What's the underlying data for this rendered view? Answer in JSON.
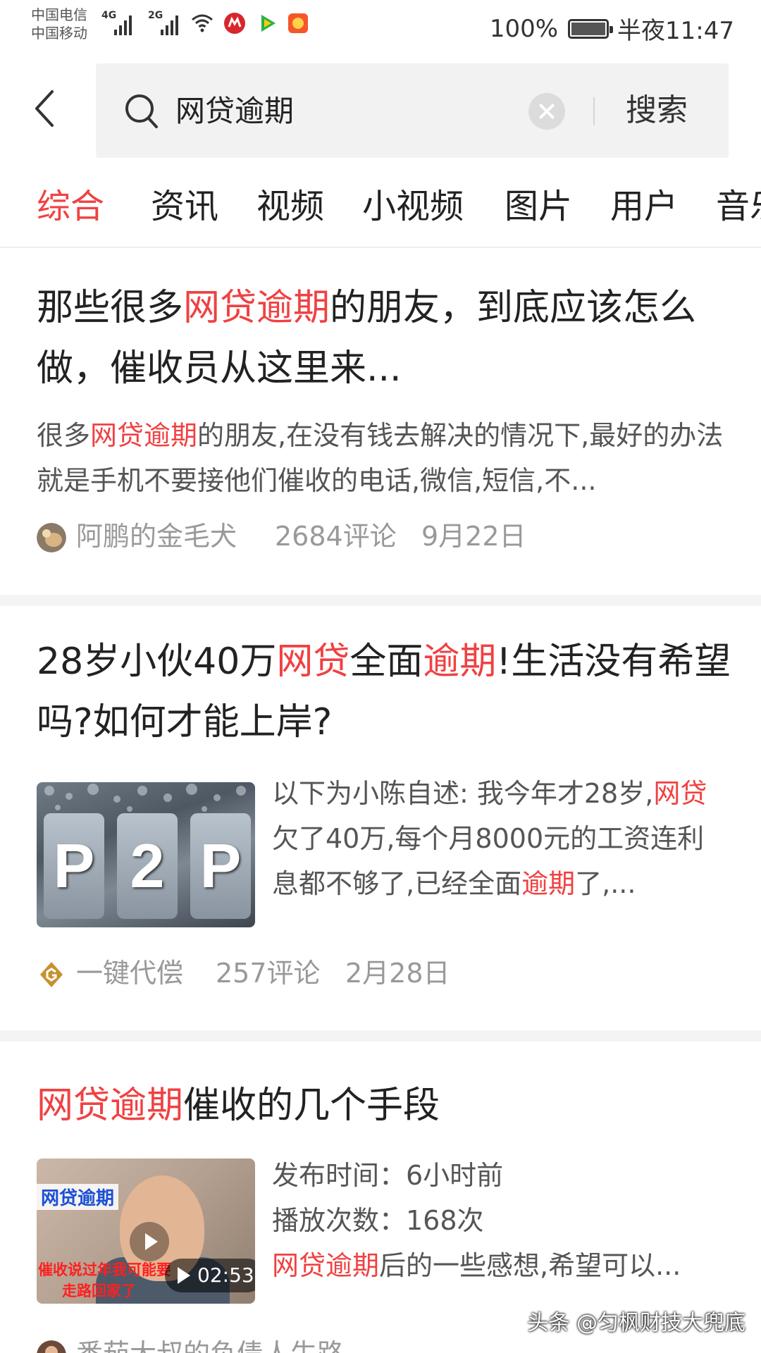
{
  "status_bar": {
    "carrier_1": "中国电信",
    "carrier_2": "中国移动",
    "network_1": "4G",
    "network_2": "2G",
    "battery": "100%",
    "time": "半夜11:47",
    "icons": [
      "wifi-icon",
      "cmb-bank-icon",
      "video-app-icon",
      "red-app-icon"
    ]
  },
  "search": {
    "query": "网贷逾期",
    "button_label": "搜索"
  },
  "tabs": [
    "综合",
    "资讯",
    "视频",
    "小视频",
    "图片",
    "用户",
    "音乐"
  ],
  "articles": [
    {
      "title_parts": [
        "那些很多",
        "网贷逾期",
        "的朋友，到底应该怎么做，催收员从这里来..."
      ],
      "summary_parts": [
        "很多",
        "网贷逾期",
        "的朋友,在没有钱去解决的情况下,最好的办法就是手机不要接他们催收的电话,微信,短信,不..."
      ],
      "source": "阿鹏的金毛犬",
      "comments": "2684评论",
      "date": "9月22日"
    },
    {
      "title_parts": [
        "28岁小伙40万",
        "网贷",
        "全面",
        "逾期",
        "!生活没有希望吗?如何才能上岸?"
      ],
      "summary_parts": [
        "以下为小陈自述: 我今年才28岁,",
        "网贷",
        "欠了40万,每个月8000元的工资连利息都不够了,已经全面",
        "逾期",
        "了,..."
      ],
      "thumbnail_text": [
        "P",
        "2",
        "P"
      ],
      "source": "一键代偿",
      "comments": "257评论",
      "date": "2月28日"
    },
    {
      "title_parts": [
        "网贷逾期",
        "催收的几个手段"
      ],
      "publish_time": "发布时间：6小时前",
      "play_count": "播放次数：168次",
      "summary_parts": [
        "网贷逾期",
        "后的一些感想,希望可以..."
      ],
      "thumbnail_title": "网贷逾期",
      "thumbnail_caption_1": "催收说过年我可能要",
      "thumbnail_caption_2": "走路回家了",
      "duration": "02:53",
      "source": "番茄大叔的负债人生路"
    }
  ],
  "watermark": "头条 @匀枫财技大兜底",
  "colors": {
    "accent": "#f04142",
    "text": "#222222",
    "meta": "#999999",
    "summary": "#555555"
  }
}
